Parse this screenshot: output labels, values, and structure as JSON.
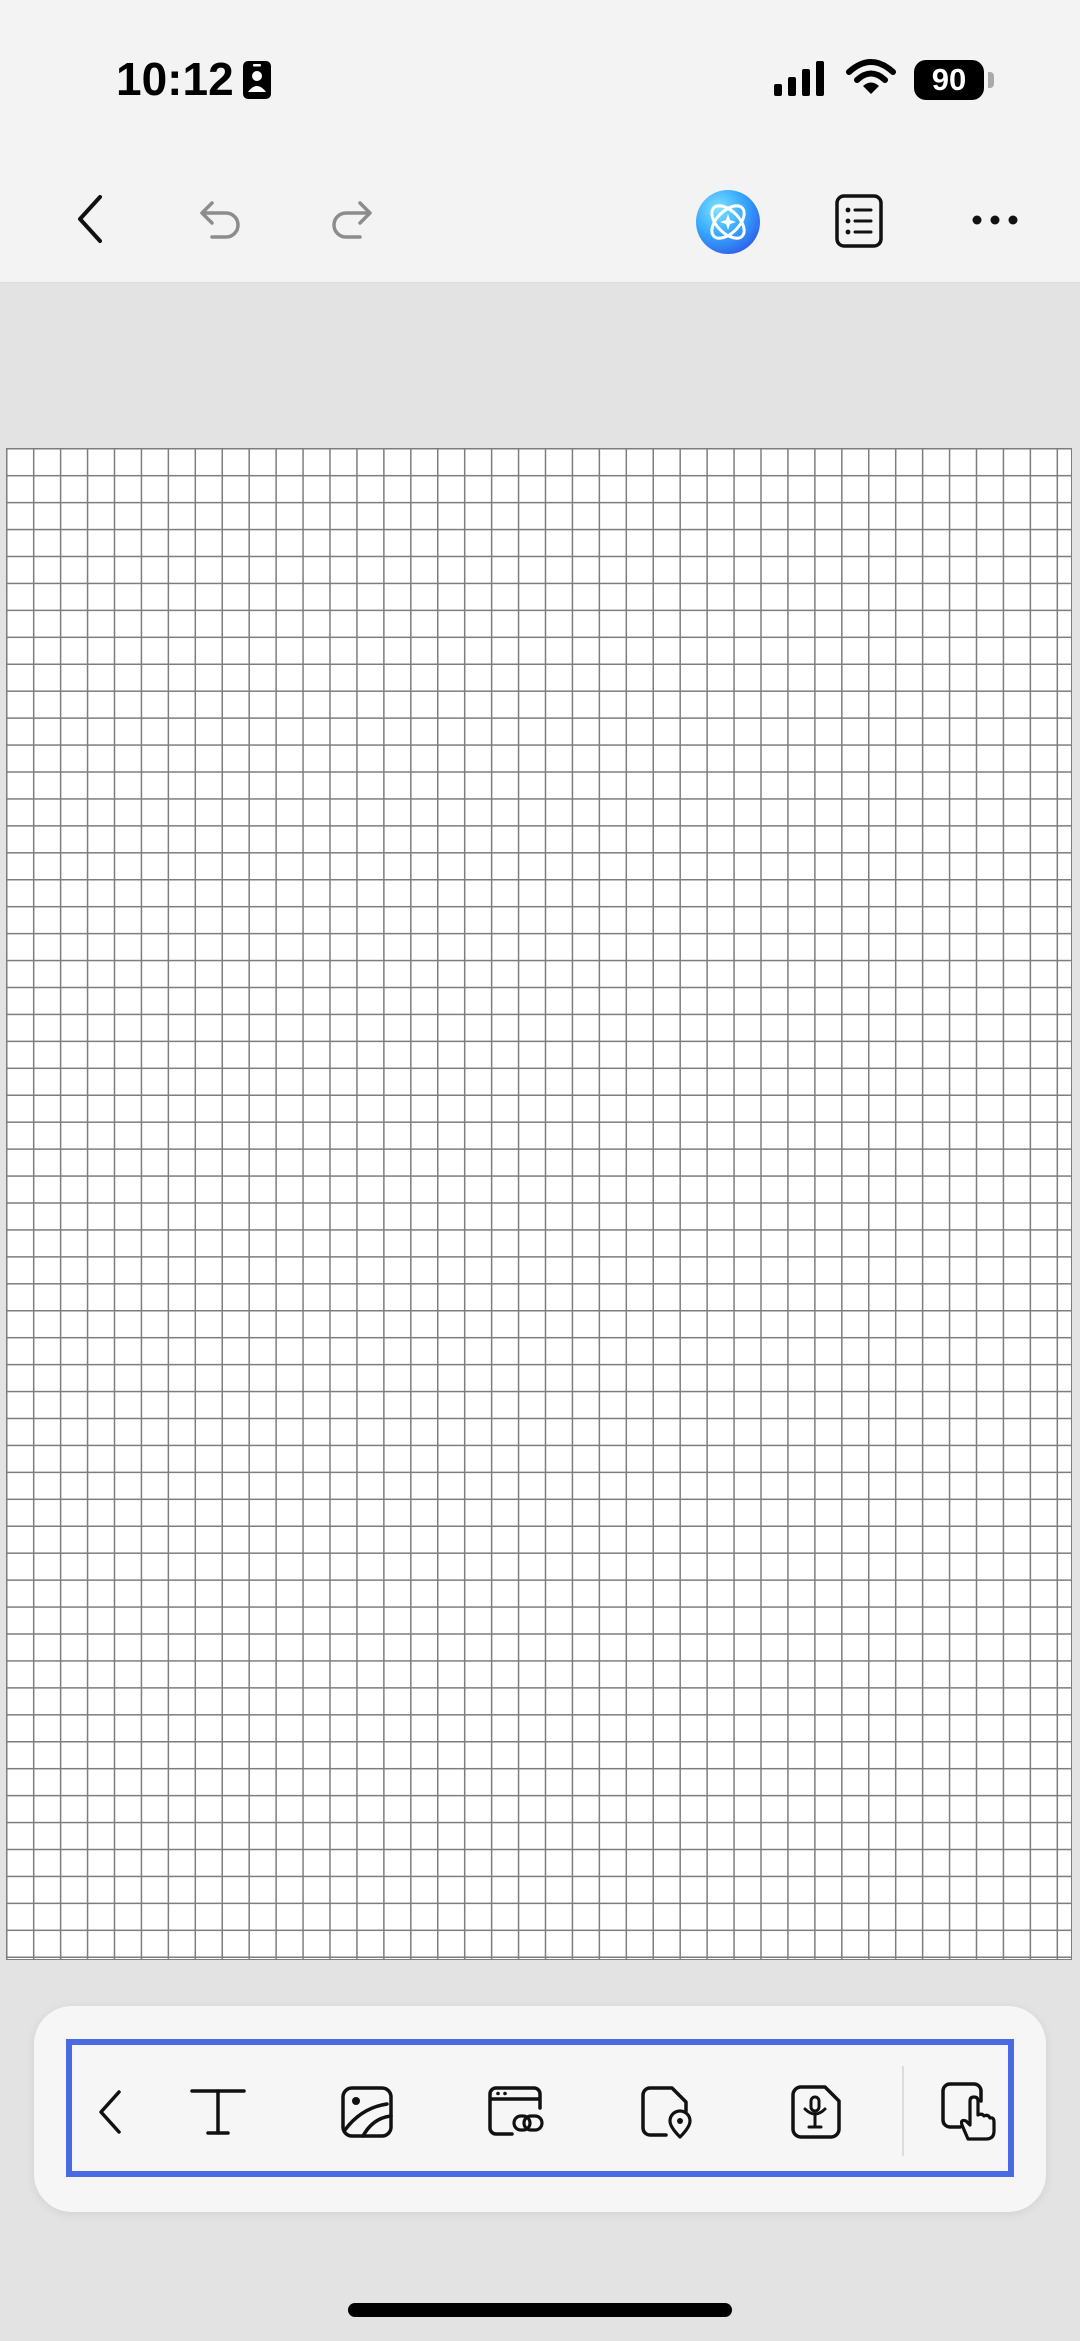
{
  "status_bar": {
    "time": "10:12",
    "battery_level": "90",
    "icons": [
      "contact-card-icon",
      "cellular-signal-icon",
      "wifi-icon",
      "battery-icon"
    ]
  },
  "toolbar": {
    "back": "back-chevron-icon",
    "undo": "undo-icon",
    "redo": "redo-icon",
    "ai_assistant": "ai-assistant-icon",
    "outline": "outline-list-icon",
    "more": "more-icon"
  },
  "canvas": {
    "background": "grid-paper"
  },
  "insert_toolbar": {
    "tools": [
      "collapse-chevron-icon",
      "text-icon",
      "image-icon",
      "web-link-icon",
      "location-icon",
      "audio-icon",
      "touch-mode-icon"
    ]
  },
  "colors": {
    "accent_highlight": "#4a6ae3",
    "ai_gradient_start": "#36c5ff",
    "ai_gradient_end": "#2e63ea"
  }
}
